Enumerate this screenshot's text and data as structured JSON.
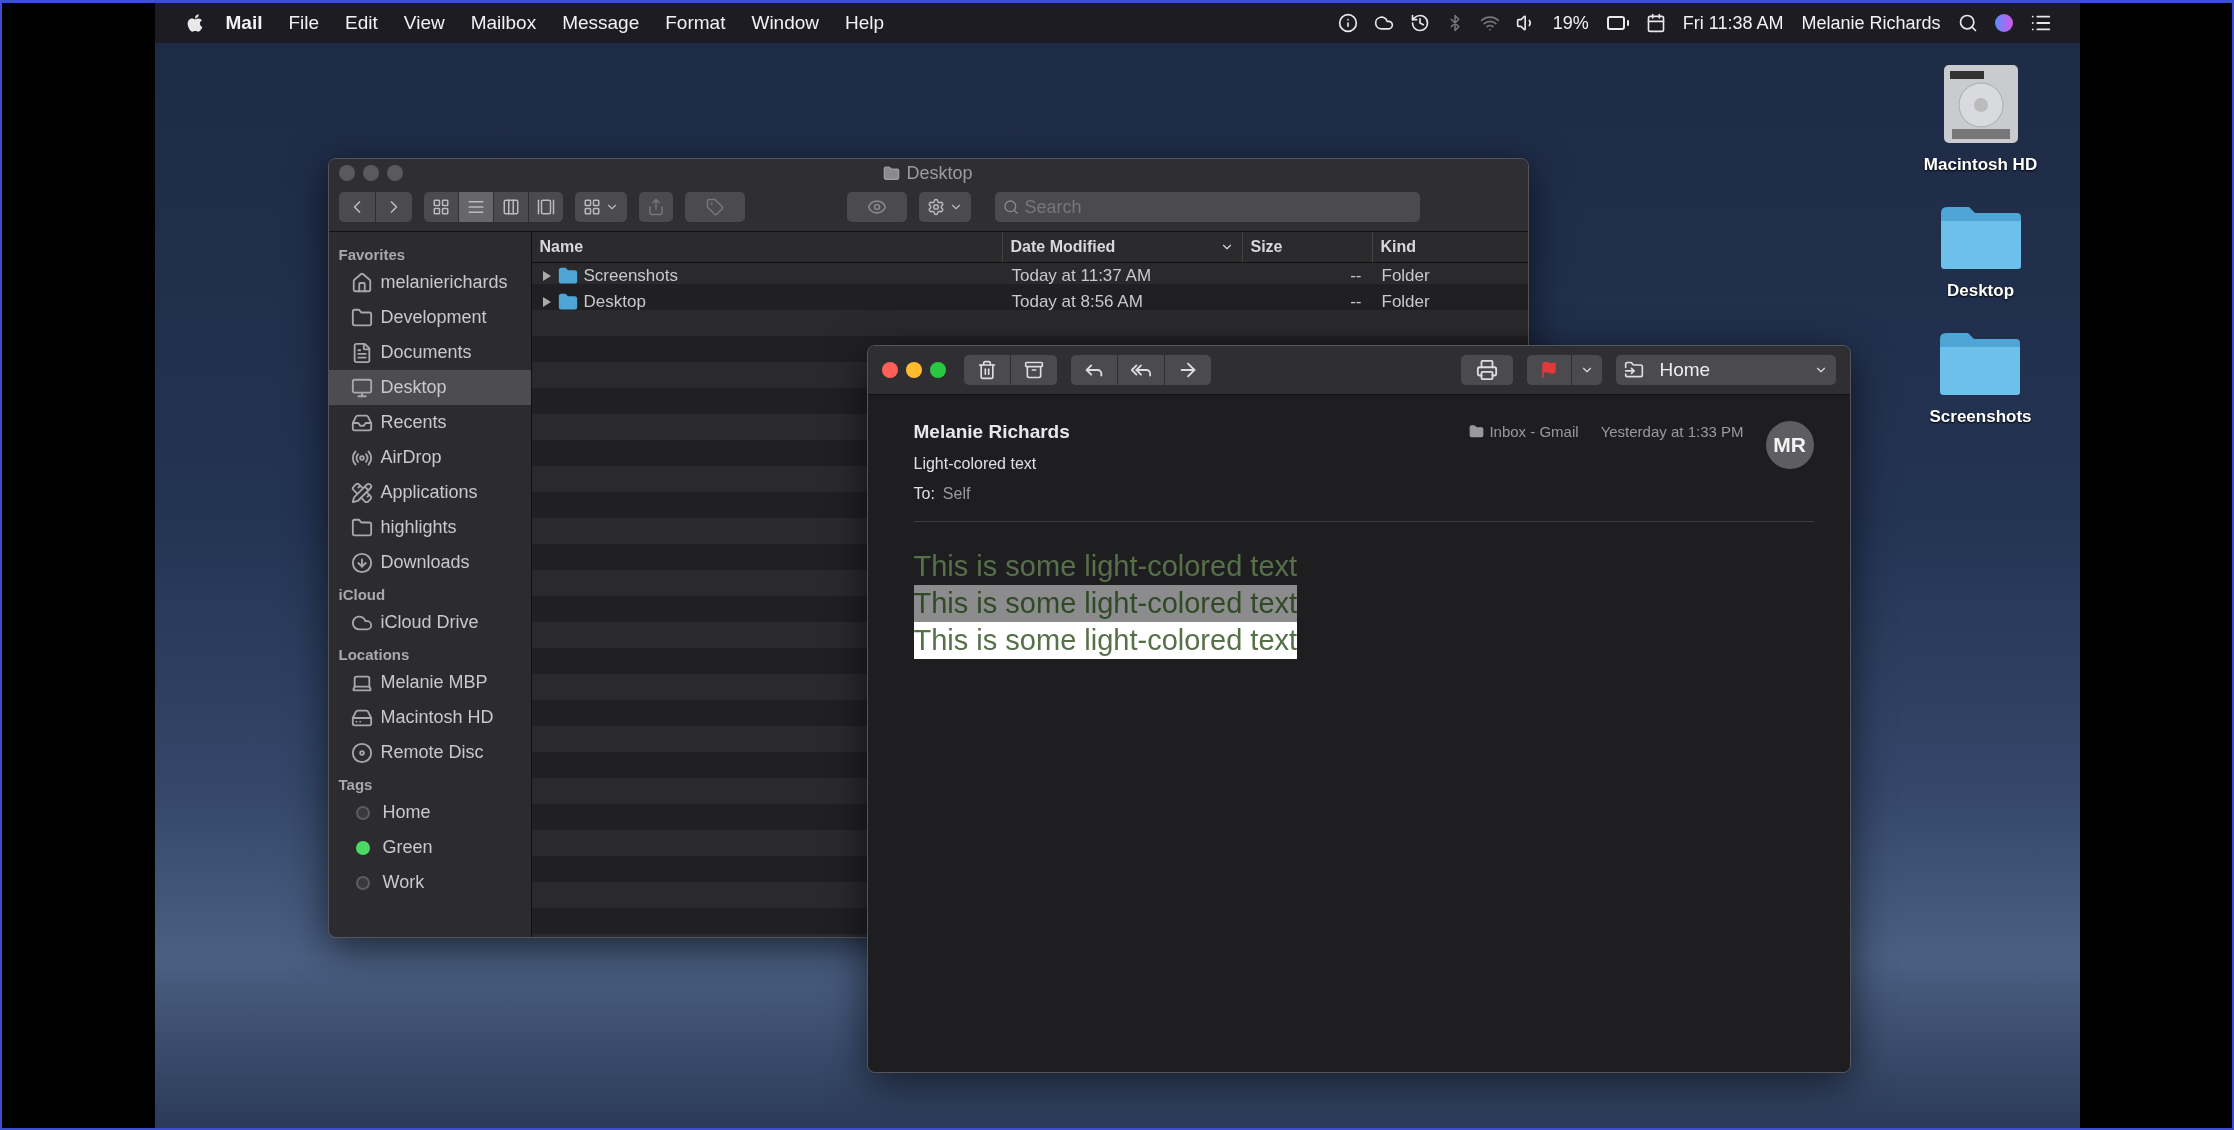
{
  "menu_bar": {
    "app": "Mail",
    "items": [
      "File",
      "Edit",
      "View",
      "Mailbox",
      "Message",
      "Format",
      "Window",
      "Help"
    ],
    "battery": "19%",
    "clock": "Fri 11:38 AM",
    "user": "Melanie Richards"
  },
  "desktop_icons": [
    {
      "label": "Macintosh HD",
      "kind": "drive"
    },
    {
      "label": "Desktop",
      "kind": "folder"
    },
    {
      "label": "Screenshots",
      "kind": "folder"
    }
  ],
  "finder": {
    "title": "Desktop",
    "search": {
      "placeholder": "Search"
    },
    "view_modes": [
      {
        "kind": "icons",
        "selected": false
      },
      {
        "kind": "list",
        "selected": true
      },
      {
        "kind": "columns",
        "selected": false
      },
      {
        "kind": "gallery",
        "selected": false
      }
    ],
    "sidebar": [
      {
        "heading": "Favorites",
        "items": [
          {
            "label": "melanierichards",
            "kind": "home",
            "selected": false
          },
          {
            "label": "Development",
            "kind": "folder",
            "selected": false
          },
          {
            "label": "Documents",
            "kind": "documents",
            "selected": false
          },
          {
            "label": "Desktop",
            "kind": "desktop",
            "selected": true
          },
          {
            "label": "Recents",
            "kind": "recents",
            "selected": false
          },
          {
            "label": "AirDrop",
            "kind": "airdrop",
            "selected": false
          },
          {
            "label": "Applications",
            "kind": "applications",
            "selected": false
          },
          {
            "label": "highlights",
            "kind": "folder",
            "selected": false
          },
          {
            "label": "Downloads",
            "kind": "downloads",
            "selected": false
          }
        ]
      },
      {
        "heading": "iCloud",
        "items": [
          {
            "label": "iCloud Drive",
            "kind": "cloud",
            "selected": false
          }
        ]
      },
      {
        "heading": "Locations",
        "items": [
          {
            "label": "Melanie MBP",
            "kind": "laptop",
            "selected": false
          },
          {
            "label": "Macintosh HD",
            "kind": "drive",
            "selected": false
          },
          {
            "label": "Remote Disc",
            "kind": "disc",
            "selected": false
          }
        ]
      },
      {
        "heading": "Tags",
        "items": [
          {
            "label": "Home",
            "kind": "tag",
            "color": "#3a3a3c",
            "selected": false
          },
          {
            "label": "Green",
            "kind": "tag",
            "color": "#4cd964",
            "selected": false
          },
          {
            "label": "Work",
            "kind": "tag",
            "color": "#3a3a3c",
            "selected": false
          }
        ]
      }
    ],
    "columns": [
      "Name",
      "Date Modified",
      "Size",
      "Kind"
    ],
    "rows": [
      {
        "name": "Screenshots",
        "date": "Today at 11:37 AM",
        "size": "--",
        "kind": "Folder",
        "selected": false
      },
      {
        "name": "Desktop",
        "date": "Today at 8:56 AM",
        "size": "--",
        "kind": "Folder",
        "selected": false
      }
    ]
  },
  "mail": {
    "mailbox_menu": "Home",
    "from": "Melanie Richards",
    "subject": "Light-colored text",
    "to_label": "To:",
    "to": "Self",
    "mailbox": "Inbox - Gmail",
    "date": "Yesterday at 1:33 PM",
    "avatar": "MR",
    "body": [
      {
        "text": "This is some light-colored text",
        "kind": "plain"
      },
      {
        "text": "This is some light-colored text",
        "kind": "shaded"
      },
      {
        "text": "This is some light-colored text",
        "kind": "inverted"
      }
    ]
  }
}
